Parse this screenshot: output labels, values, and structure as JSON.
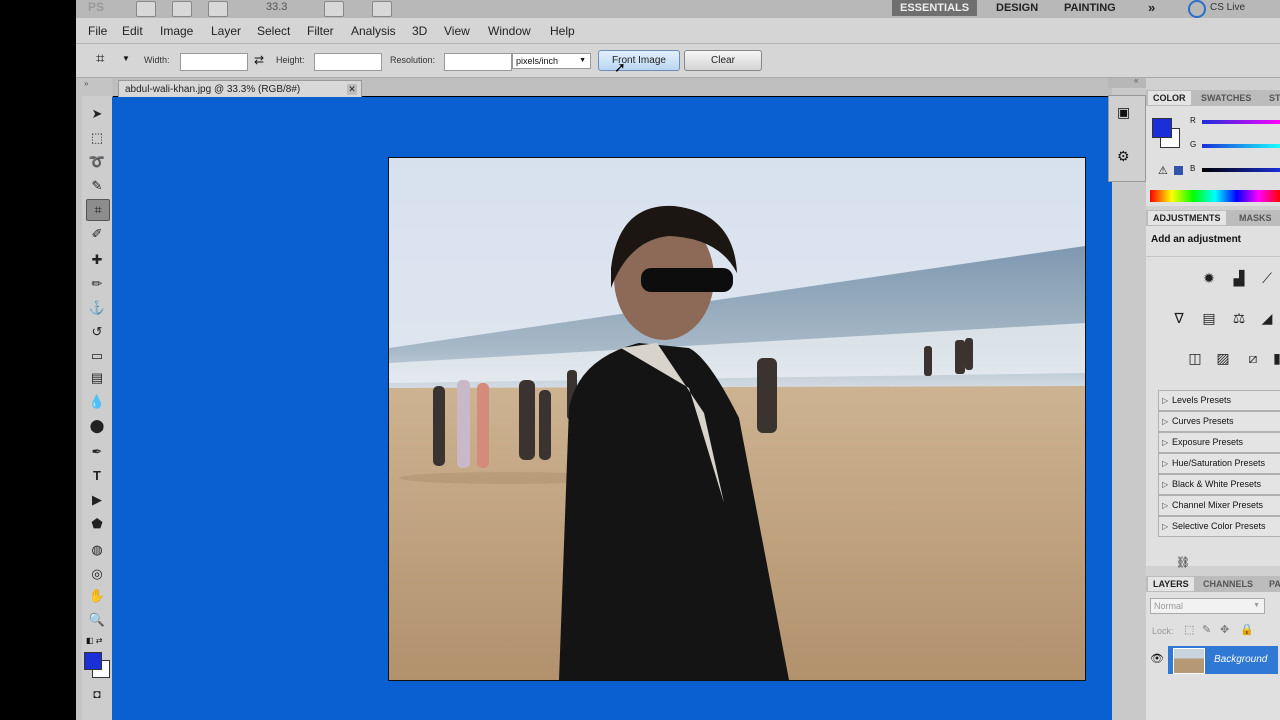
{
  "app": {
    "logo": "PS",
    "zoom": "33.3",
    "workspaces": [
      "ESSENTIALS",
      "DESIGN",
      "PAINTING"
    ],
    "more": "»",
    "cs_live": "CS Live"
  },
  "menu": [
    "File",
    "Edit",
    "Image",
    "Layer",
    "Select",
    "Filter",
    "Analysis",
    "3D",
    "View",
    "Window",
    "Help"
  ],
  "options": {
    "width_label": "Width:",
    "height_label": "Height:",
    "resolution_label": "Resolution:",
    "width_value": "",
    "height_value": "",
    "resolution_value": "",
    "unit": "pixels/inch",
    "front_image": "Front Image",
    "clear": "Clear"
  },
  "document": {
    "tab_title": "abdul-wali-khan.jpg @ 33.3% (RGB/8#)",
    "canvas_color": "#0a5fd1"
  },
  "color_panel": {
    "tabs": [
      "COLOR",
      "SWATCHES",
      "STYLES"
    ],
    "r": "R",
    "g": "G",
    "b": "B",
    "foreground": "#1a2fd8"
  },
  "adjustments": {
    "tabs": [
      "ADJUSTMENTS",
      "MASKS"
    ],
    "title": "Add an adjustment",
    "presets": [
      "Levels Presets",
      "Curves Presets",
      "Exposure Presets",
      "Hue/Saturation Presets",
      "Black & White Presets",
      "Channel Mixer Presets",
      "Selective Color Presets"
    ]
  },
  "layers": {
    "tabs": [
      "LAYERS",
      "CHANNELS",
      "PATHS"
    ],
    "blend": "Normal",
    "lock": "Lock:",
    "layer_name": "Background"
  }
}
